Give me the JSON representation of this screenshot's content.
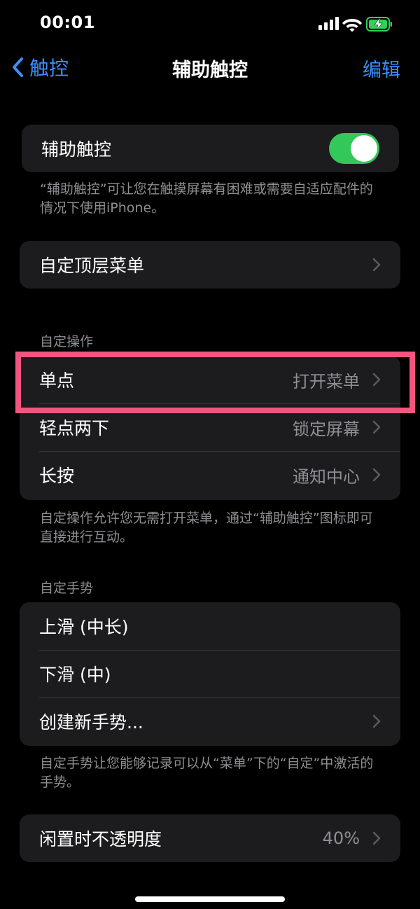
{
  "status_bar": {
    "time": "00:01",
    "icons": [
      "cellular-signal-icon",
      "wifi-icon",
      "battery-charging-icon"
    ],
    "battery_color": "#30d158"
  },
  "nav": {
    "back_label": "触控",
    "title": "辅助触控",
    "edit_label": "编辑",
    "accent_color": "#3d8ef5"
  },
  "assistive_touch": {
    "label": "辅助触控",
    "enabled": true,
    "footer": "“辅助触控”可让您在触摸屏幕有困难或需要自适应配件的情况下使用iPhone。"
  },
  "top_menu": {
    "label": "自定顶层菜单"
  },
  "custom_actions": {
    "header": "自定操作",
    "rows": [
      {
        "label": "单点",
        "value": "打开菜单"
      },
      {
        "label": "轻点两下",
        "value": "锁定屏幕"
      },
      {
        "label": "长按",
        "value": "通知中心"
      }
    ],
    "footer": "自定操作允许您无需打开菜单，通过“辅助触控”图标即可直接进行互动。"
  },
  "custom_gestures": {
    "header": "自定手势",
    "rows": [
      {
        "label": "上滑 (中长)"
      },
      {
        "label": "下滑 (中)"
      },
      {
        "label": "创建新手势..."
      }
    ],
    "footer": "自定手势让您能够记录可以从“菜单”下的“自定”中激活的手势。"
  },
  "idle_opacity": {
    "label": "闲置时不透明度",
    "value": "40%"
  },
  "highlight_color": "#f2557f"
}
